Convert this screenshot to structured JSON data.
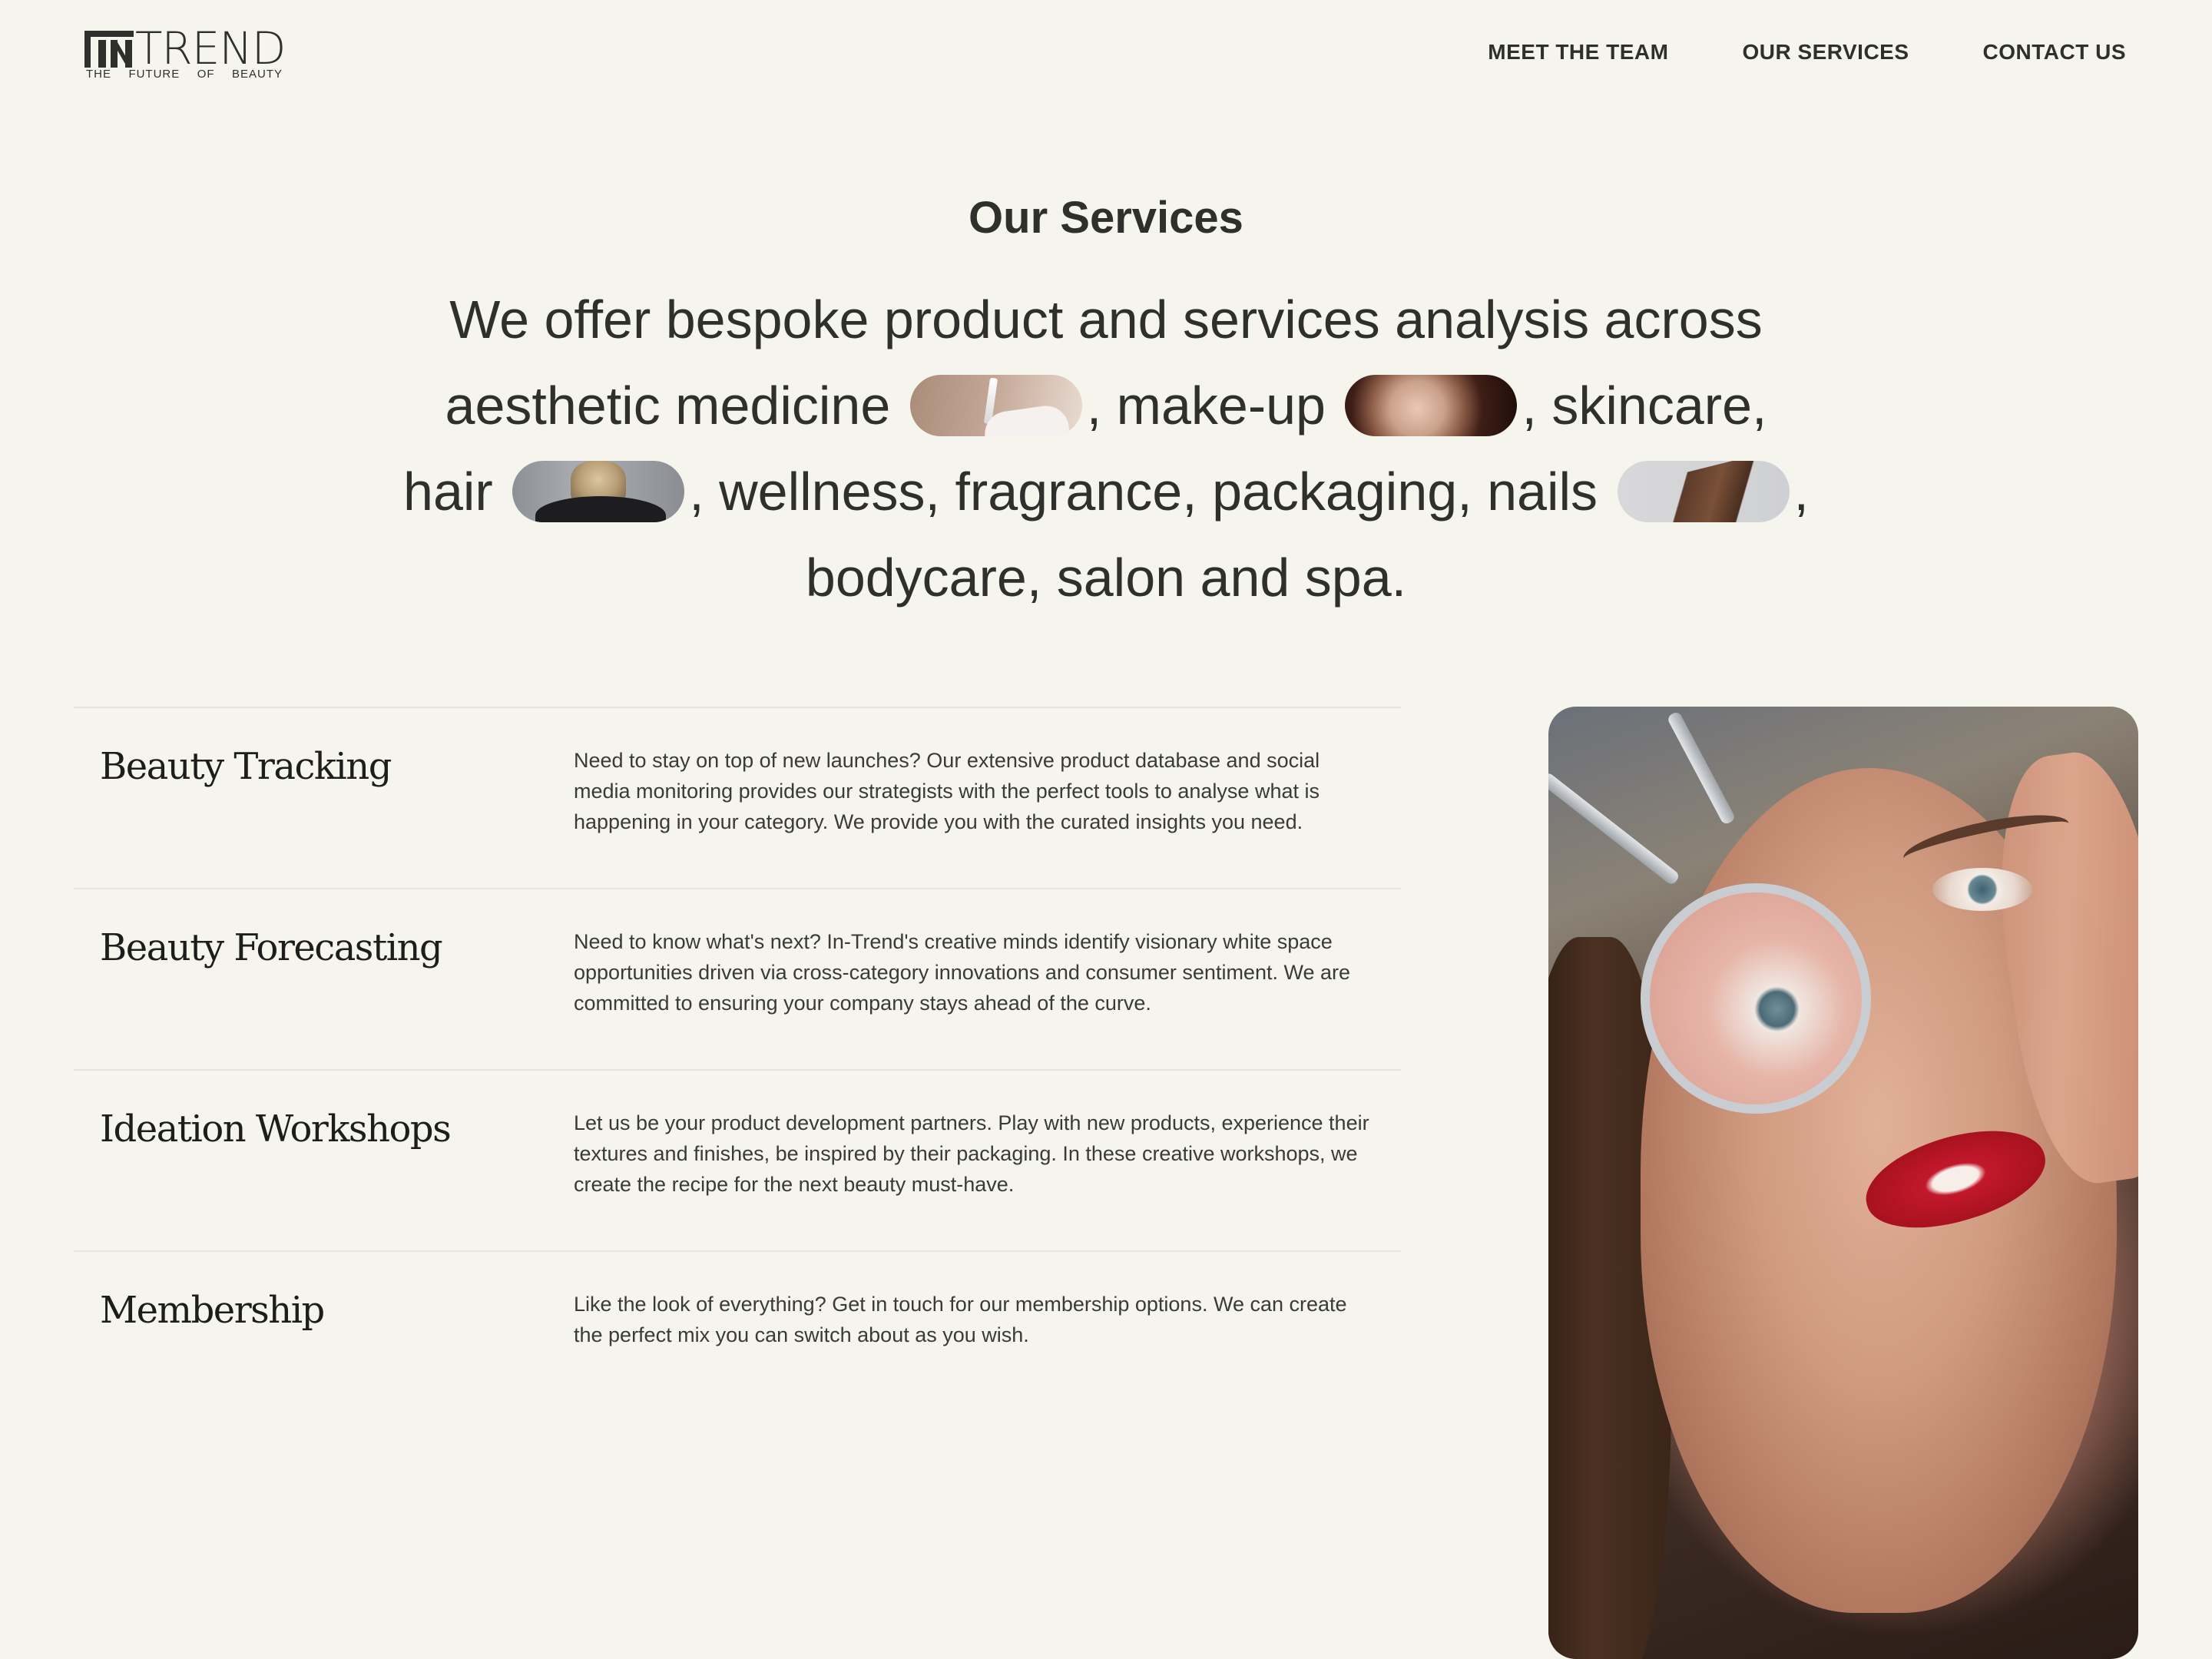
{
  "header": {
    "logo": {
      "mark": "IN",
      "word": "TREND",
      "tagline": [
        "THE",
        "FUTURE",
        "OF",
        "BEAUTY"
      ]
    },
    "nav": [
      {
        "label": "MEET THE TEAM"
      },
      {
        "label": "OUR SERVICES"
      },
      {
        "label": "CONTACT US"
      }
    ]
  },
  "intro": {
    "title": "Our Services",
    "line1": "We offer bespoke product and services analysis across",
    "part_medicine": "aesthetic medicine",
    "part_makeup": ", make-up",
    "part_skincare": ", skincare,",
    "part_hair": "hair",
    "part_mid": ", wellness, fragrance, packaging, nails",
    "part_comma": ",",
    "line4": "bodycare, salon and spa."
  },
  "services": [
    {
      "name": "Beauty Tracking",
      "description": "Need to stay on top of new launches? Our extensive product database and social media monitoring provides our strategists with the perfect tools to analyse what is happening in your category. We provide you with the curated insights you need."
    },
    {
      "name": "Beauty Forecasting",
      "description": "Need to know what's next? In-Trend's creative minds identify visionary white space opportunities driven via cross-category innovations and consumer sentiment. We are committed to ensuring your company stays ahead of the curve."
    },
    {
      "name": "Ideation Workshops",
      "description": "Let us be your product development partners. Play with new products, experience their textures and finishes, be inspired by their packaging. In these creative workshops, we create the recipe for the next beauty must-have."
    },
    {
      "name": "Membership",
      "description": "Like the look of everything? Get in touch for our membership options. We can create the perfect mix you can switch about as you wish."
    }
  ],
  "colors": {
    "background": "#f5f4ed",
    "text": "#2f2f2c",
    "divider": "#e6e4dc"
  }
}
